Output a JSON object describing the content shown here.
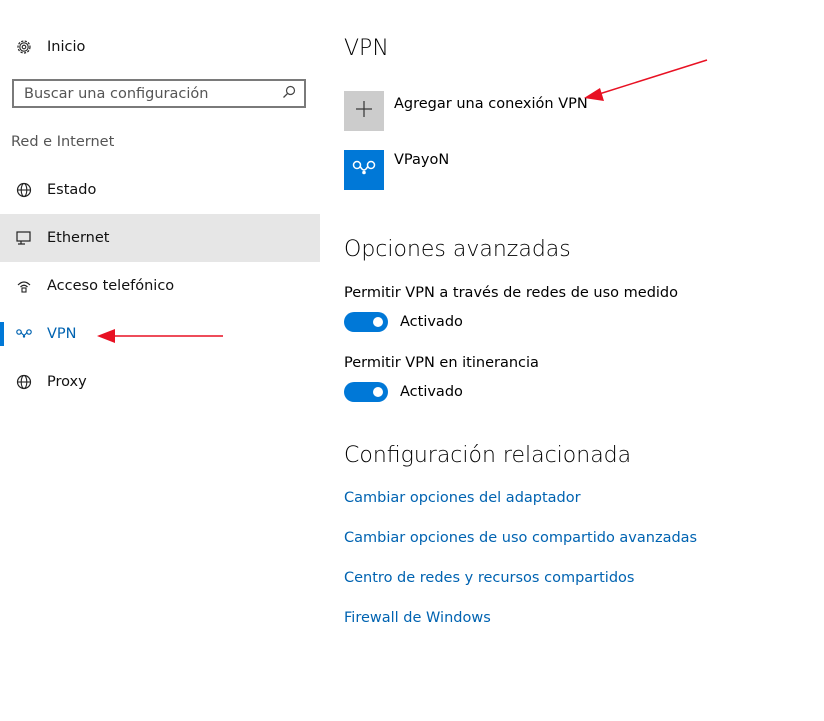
{
  "sidebar": {
    "home_label": "Inicio",
    "search_placeholder": "Buscar una configuración",
    "section_title": "Red e Internet",
    "items": [
      {
        "label": "Estado"
      },
      {
        "label": "Ethernet"
      },
      {
        "label": "Acceso telefónico"
      },
      {
        "label": "VPN"
      },
      {
        "label": "Proxy"
      }
    ]
  },
  "main": {
    "title": "VPN",
    "add_connection_label": "Agregar una conexión VPN",
    "connections": [
      {
        "name": "VPayoN"
      }
    ],
    "advanced": {
      "title": "Opciones avanzadas",
      "options": [
        {
          "label": "Permitir VPN a través de redes de uso medido",
          "state_text": "Activado",
          "on": true
        },
        {
          "label": "Permitir VPN en itinerancia",
          "state_text": "Activado",
          "on": true
        }
      ]
    },
    "related": {
      "title": "Configuración relacionada",
      "links": [
        {
          "label": "Cambiar opciones del adaptador"
        },
        {
          "label": "Cambiar opciones de uso compartido avanzadas"
        },
        {
          "label": "Centro de redes y recursos compartidos"
        },
        {
          "label": "Firewall de Windows"
        }
      ]
    }
  },
  "colors": {
    "accent": "#0078d7",
    "link": "#0063b1",
    "selected_bg": "#e6e6e6",
    "annotation_arrow": "#e81123"
  }
}
